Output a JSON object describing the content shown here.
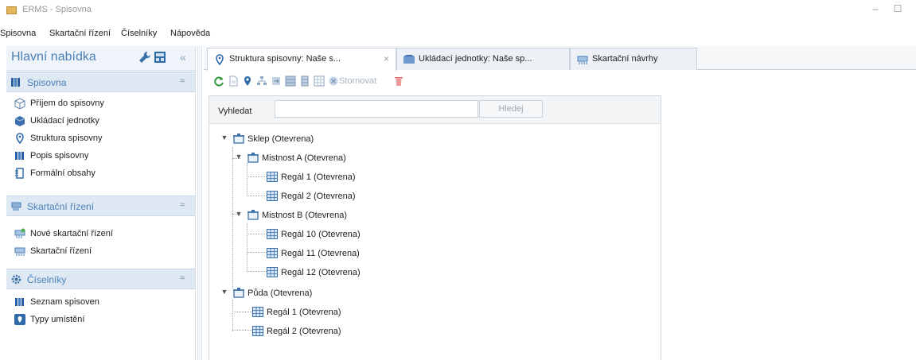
{
  "window": {
    "title": "ERMS - Spisovna",
    "minimize": "–",
    "maximize": "☐"
  },
  "menu": [
    "Spisovna",
    "Skartační řízení",
    "Číselníky",
    "Nápověda"
  ],
  "sidebar": {
    "title": "Hlavní nabídka",
    "collapse": "«",
    "sections": [
      {
        "label": "Spisovna",
        "icon": "books-icon",
        "items": [
          {
            "label": "Příjem do spisovny",
            "icon": "box-icon"
          },
          {
            "label": "Ukládací jednotky",
            "icon": "storage-unit-icon"
          },
          {
            "label": "Struktura spisovny",
            "icon": "location-pin-icon"
          },
          {
            "label": "Popis spisovny",
            "icon": "books-icon"
          },
          {
            "label": "Formální obsahy",
            "icon": "form-icon"
          }
        ]
      },
      {
        "label": "Skartační řízení",
        "icon": "shredder-icon",
        "items": [
          {
            "label": "Nové skartační řízení",
            "icon": "new-shredding-icon"
          },
          {
            "label": "Skartační řízení",
            "icon": "shredder-icon"
          }
        ]
      },
      {
        "label": "Číselníky",
        "icon": "gear-icon",
        "items": [
          {
            "label": "Seznam spisoven",
            "icon": "books-icon"
          },
          {
            "label": "Typy umístění",
            "icon": "location-type-icon"
          }
        ]
      }
    ],
    "chevron": "≈"
  },
  "tabs": [
    {
      "label": "Struktura spisovny: Naše s...",
      "active": true,
      "close": "×"
    },
    {
      "label": "Ukládací jednotky: Naše sp...",
      "active": false
    },
    {
      "label": "Skartační návrhy",
      "active": false
    }
  ],
  "toolbar": {
    "storno_label": "Stornovat"
  },
  "search": {
    "label": "Vyhledat",
    "value": "",
    "button": "Hledej"
  },
  "tree": [
    {
      "label": "Sklep (Otevrena)",
      "kind": "building",
      "expander": "▼",
      "children": [
        {
          "label": "Mistnost A (Otevrena)",
          "kind": "building",
          "expander": "▼",
          "children": [
            {
              "label": "Regál 1 (Otevrena)",
              "kind": "shelf"
            },
            {
              "label": "Regál 2 (Otevrena)",
              "kind": "shelf"
            }
          ]
        },
        {
          "label": "Mistnost B (Otevrena)",
          "kind": "building",
          "expander": "▼",
          "children": [
            {
              "label": "Regál 10 (Otevrena)",
              "kind": "shelf"
            },
            {
              "label": "Regál 11 (Otevrena)",
              "kind": "shelf"
            },
            {
              "label": "Regál 12 (Otevrena)",
              "kind": "shelf"
            }
          ]
        }
      ]
    },
    {
      "label": "Půda (Otevrena)",
      "kind": "building",
      "expander": "▼",
      "children": [
        {
          "label": "Regál 1 (Otevrena)",
          "kind": "shelf"
        },
        {
          "label": "Regál 2 (Otevrena)",
          "kind": "shelf"
        }
      ]
    }
  ]
}
